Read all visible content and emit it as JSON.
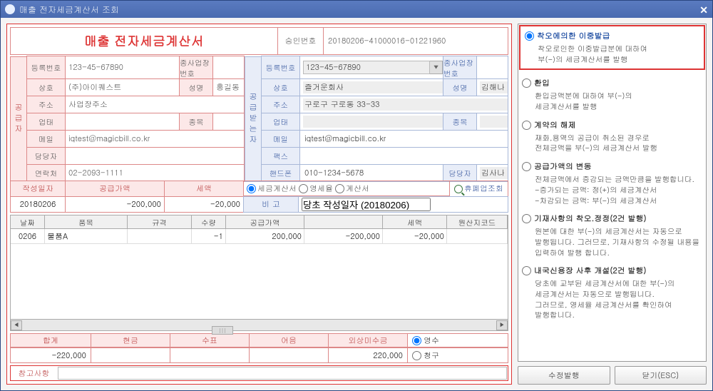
{
  "window_title": "매출 전자세금계산서 조회",
  "main_title": "매출 전자세금계산서",
  "approval": {
    "label": "승인번호",
    "value": "20180206-41000016-01221960"
  },
  "supplier": {
    "section": "공급자",
    "reg_label": "등록번호",
    "reg": "123-45-67890",
    "branch_label": "종사업장번호",
    "branch": "",
    "name_label": "상호",
    "name": "(주)아이퀘스트",
    "ceo_label": "성명",
    "ceo": "홍길동",
    "addr_label": "주소",
    "addr": "사업장주소",
    "biz_label": "업태",
    "biz": "",
    "item_label": "종목",
    "item": "",
    "mail_label": "메일",
    "mail": "iqtest@magicbill.co.kr",
    "mgr_label": "담당자",
    "mgr": "",
    "tel_label": "연락처",
    "tel": "02-2093-1111"
  },
  "buyer": {
    "section": "공급받는자",
    "reg_label": "등록번호",
    "reg": "123-45-67890",
    "branch_label": "종사업장번호",
    "branch": "",
    "name_label": "상호",
    "name": "즐거운회사",
    "ceo_label": "성명",
    "ceo": "김해나",
    "addr_label": "주소",
    "addr": "구로구 구로동 33-33",
    "biz_label": "업태",
    "biz": "",
    "item_label": "종목",
    "item": "",
    "mail_label": "메일",
    "mail": "iqtest@magicbill.co.kr",
    "fax_label": "팩스",
    "fax": "",
    "hp_label": "핸드폰",
    "hp": "010-1234-5678",
    "mgr_label": "담당자",
    "mgr": "김사나"
  },
  "doc": {
    "date_label": "작성일자",
    "date": "20180206",
    "supply_label": "공급가액",
    "supply": "-200,000",
    "tax_label": "세액",
    "tax": "-20,000",
    "type_tax": "세금계산서",
    "type_zero": "영세율",
    "type_bill": "계산서",
    "lookup": "휴폐업조회",
    "remark_label": "비 고",
    "remark": "당초 작성일자 (20180206)"
  },
  "grid": {
    "h1": "날짜",
    "h2": "품목",
    "h3": "규격",
    "h4": "수량",
    "h5": "공급가액",
    "h6": "세액",
    "h7": "원산지코드",
    "rows": [
      {
        "date": "0206",
        "item": "물품A",
        "spec": "",
        "qty": "-1",
        "supply": "200,000",
        "supply2": "-200,000",
        "tax": "-20,000",
        "origin": ""
      }
    ]
  },
  "totals": {
    "sum_label": "합계",
    "cash_label": "현금",
    "check_label": "수표",
    "note_label": "어음",
    "credit_label": "외상미수금",
    "sum": "-220,000",
    "cash": "",
    "check": "",
    "note": "",
    "credit": "220,000",
    "receive": "영수",
    "claim": "청구"
  },
  "note_label": "참고사항",
  "note": "",
  "options": [
    {
      "key": "opt1",
      "title": "착오에의한 이중발급",
      "desc": "착오로인한 이중발급분에 대하여\n부(-)의 세금계산서를 발행",
      "selected": true
    },
    {
      "key": "opt2",
      "title": "환입",
      "desc": "환입금액분에 대하여 부(-)의\n세금계산서를 발행",
      "selected": false
    },
    {
      "key": "opt3",
      "title": "계약의 해제",
      "desc": "재화,용역의 공급이 취소된 경우로\n전체금액을 부(-)의 세금계산서 발행",
      "selected": false
    },
    {
      "key": "opt4",
      "title": "공급가액의 변동",
      "desc": "전체금액에서 증감되는 금액만큼을 발행합니다.\n-증가되는 금액: 정(+)의 세금계산서\n-차감되는 금액: 부(-)의 세금계산서",
      "selected": false
    },
    {
      "key": "opt5",
      "title": "기재사항의 착오.정정(2건 발행)",
      "desc": "원본에 대한 부(-)의 세금계산서는 자동으로\n발행됩니다. 그러므로, 기재사항의 수정될 내용을\n입력하여 발행 합니다.",
      "selected": false
    },
    {
      "key": "opt6",
      "title": "내국신용장 사후 개설(2건 발행)",
      "desc": "당초에 교부된 세금계산서에 대한 부(-)의\n세금계산서는 자동으로 발행됩니다.\n그러므로, 영세율 세금계산서를 확인하여\n발행합니다.",
      "selected": false
    }
  ],
  "buttons": {
    "issue": "수정발행",
    "close": "닫기(ESC)"
  }
}
